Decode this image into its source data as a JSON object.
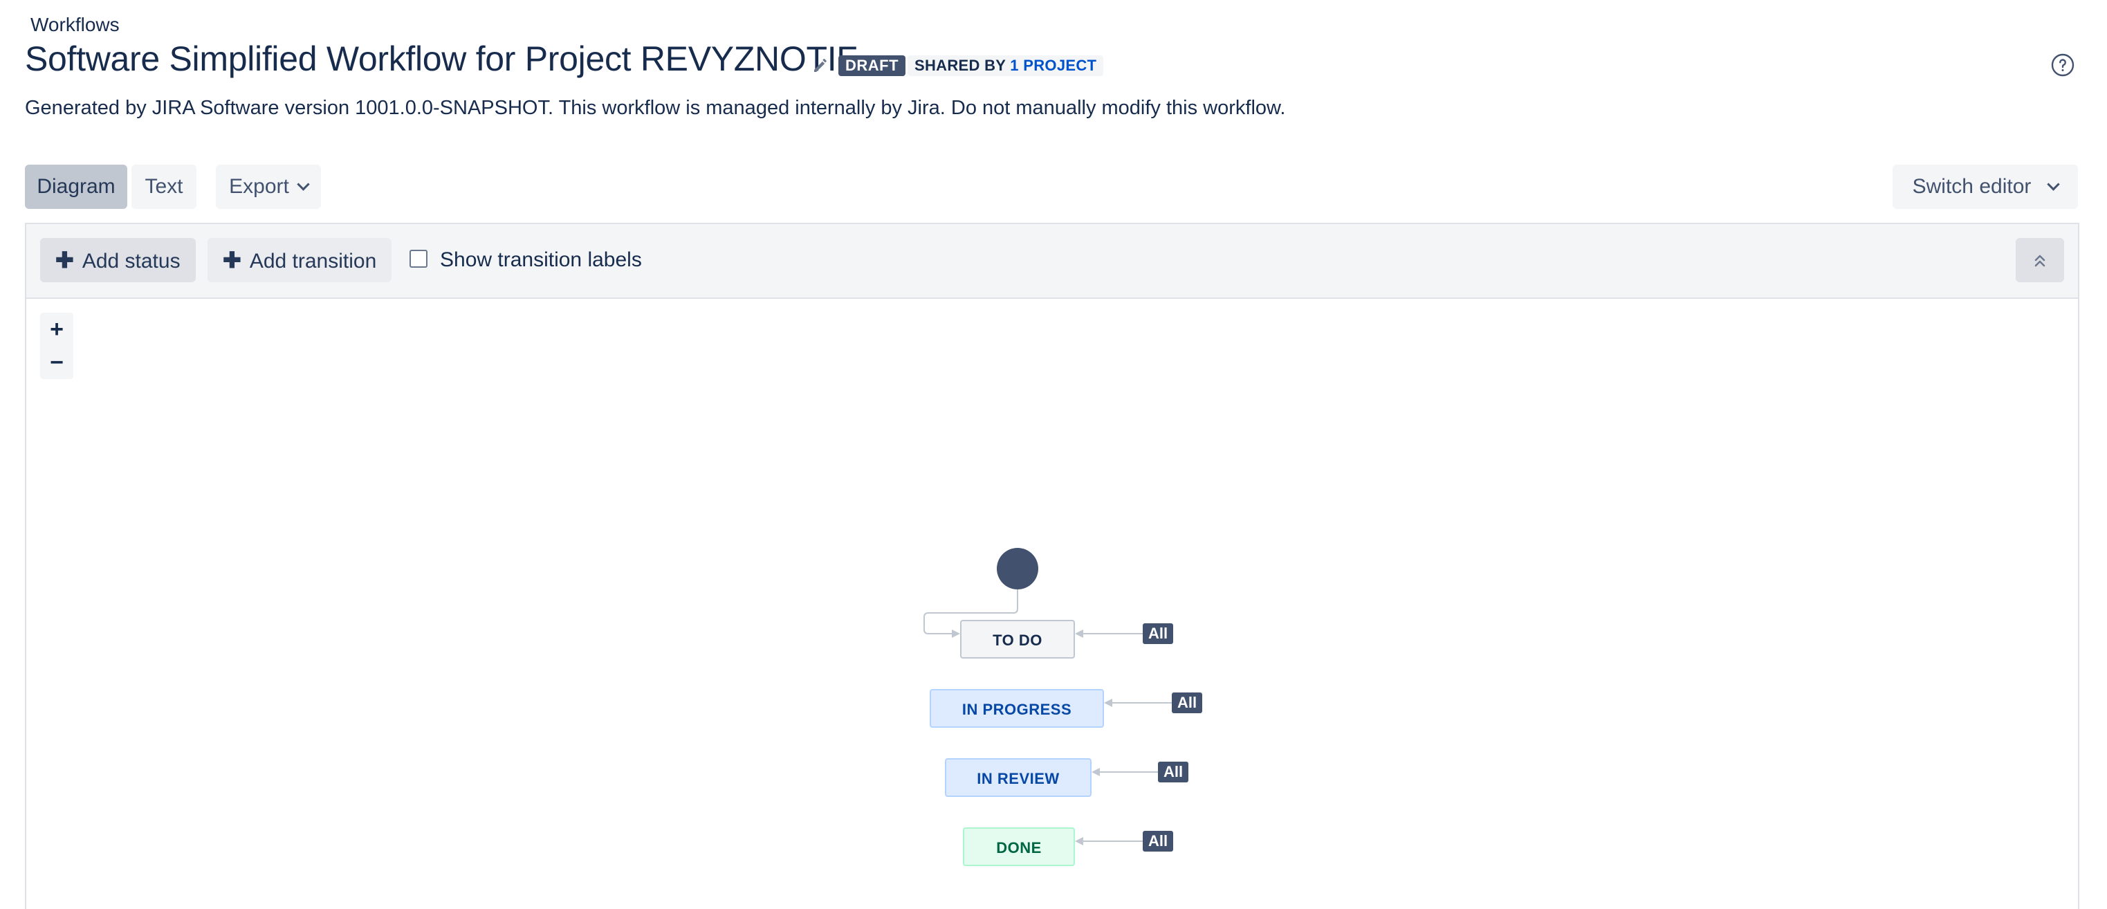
{
  "breadcrumb": "Workflows",
  "title": "Software Simplified Workflow for Project REVYZNOTIF",
  "lozenges": {
    "draft": "DRAFT",
    "shared_prefix": "SHARED BY",
    "shared_link": "1 PROJECT"
  },
  "description": "Generated by JIRA Software version 1001.0.0-SNAPSHOT. This workflow is managed internally by Jira. Do not manually modify this workflow.",
  "view_tabs": {
    "diagram": "Diagram",
    "text": "Text",
    "selected": "Diagram"
  },
  "export_label": "Export",
  "switch_editor_label": "Switch editor",
  "toolbar": {
    "add_status": "Add status",
    "add_transition": "Add transition",
    "show_labels": "Show transition labels",
    "show_labels_checked": false
  },
  "zoom": {
    "in": "+",
    "out": "−"
  },
  "statuses": [
    {
      "label": "TO DO",
      "category": "todo"
    },
    {
      "label": "IN PROGRESS",
      "category": "in-progress"
    },
    {
      "label": "IN REVIEW",
      "category": "in-progress"
    },
    {
      "label": "DONE",
      "category": "done"
    }
  ],
  "global_transition_label": "All",
  "colors": {
    "primary_text": "#172b4d",
    "link": "#0052cc",
    "lozenge_dark": "#42526e",
    "start_node": "#42526e"
  }
}
